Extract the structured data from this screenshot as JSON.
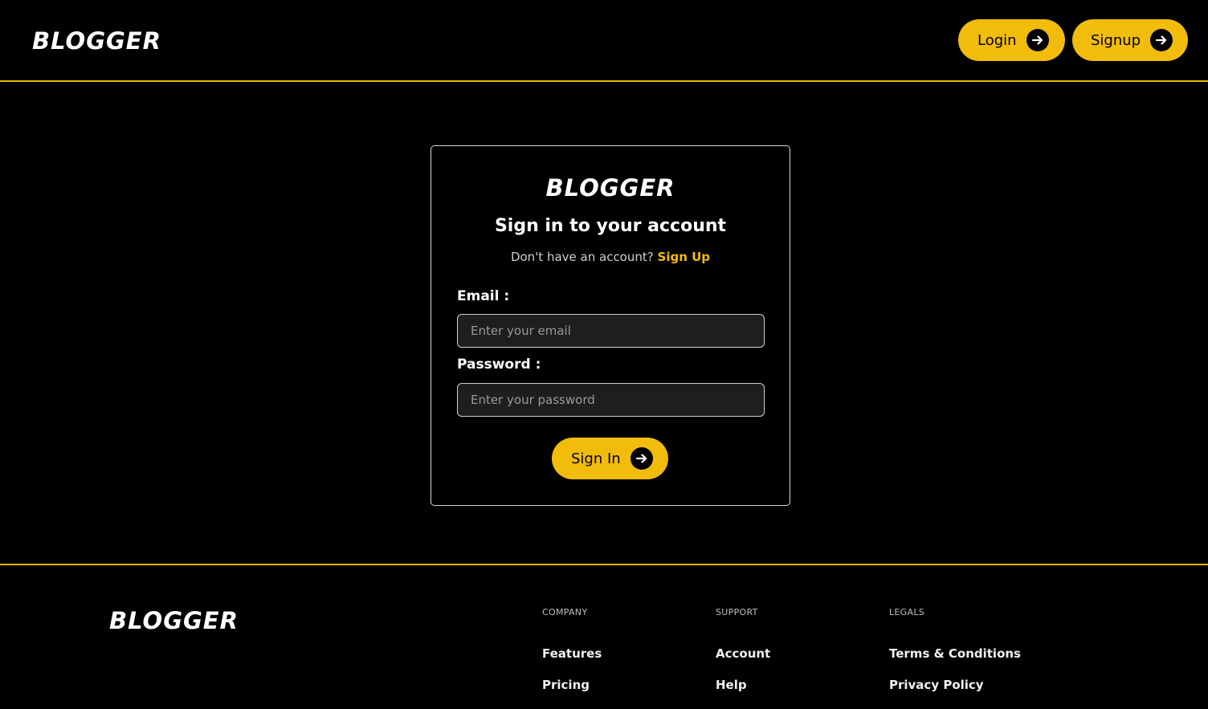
{
  "header": {
    "brand": "BLOGGER",
    "login_label": "Login",
    "signup_label": "Signup"
  },
  "form": {
    "brand": "BLOGGER",
    "title": "Sign in to your account",
    "prompt_text": "Don't have an account?",
    "signup_link": "Sign Up",
    "email_label": "Email :",
    "email_placeholder": "Enter your email",
    "password_label": "Password :",
    "password_placeholder": "Enter your password",
    "submit_label": "Sign In"
  },
  "footer": {
    "brand": "BLOGGER",
    "columns": [
      {
        "heading": "COMPANY",
        "links": [
          "Features",
          "Pricing"
        ]
      },
      {
        "heading": "SUPPORT",
        "links": [
          "Account",
          "Help"
        ]
      },
      {
        "heading": "LEGALS",
        "links": [
          "Terms & Conditions",
          "Privacy Policy"
        ]
      }
    ]
  },
  "icons": {
    "login": "arrow-right-icon",
    "signup": "arrow-right-icon",
    "submit": "arrow-right-icon"
  },
  "colors": {
    "accent": "#f2bc0a",
    "background": "#000000",
    "input_background": "#1e1e1e"
  }
}
